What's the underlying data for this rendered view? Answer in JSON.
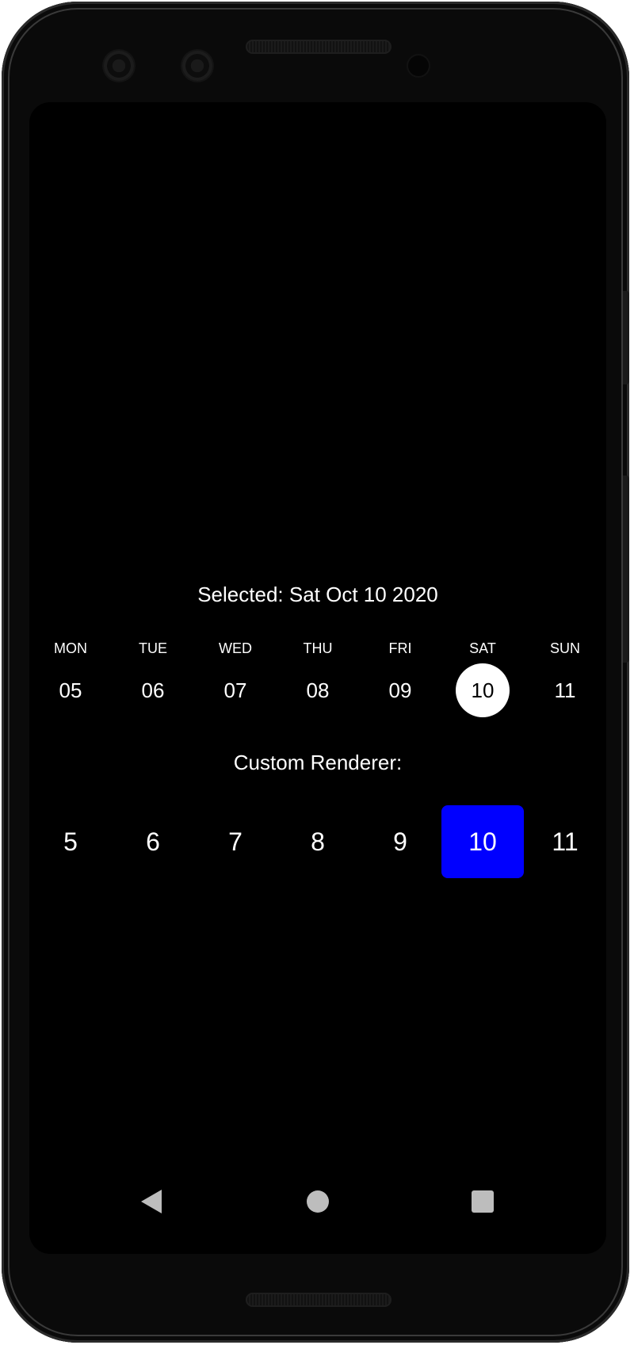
{
  "selected": {
    "label": "Selected: Sat Oct 10 2020"
  },
  "week": {
    "days": [
      {
        "weekday": "MON",
        "number": "05"
      },
      {
        "weekday": "TUE",
        "number": "06"
      },
      {
        "weekday": "WED",
        "number": "07"
      },
      {
        "weekday": "THU",
        "number": "08"
      },
      {
        "weekday": "FRI",
        "number": "09"
      },
      {
        "weekday": "SAT",
        "number": "10"
      },
      {
        "weekday": "SUN",
        "number": "11"
      }
    ],
    "selected_index": 5
  },
  "custom": {
    "label": "Custom Renderer:",
    "days": [
      "5",
      "6",
      "7",
      "8",
      "9",
      "10",
      "11"
    ],
    "selected_index": 5,
    "selected_color": "#0000ff"
  },
  "navbar": {
    "back_icon": "back-triangle-icon",
    "home_icon": "home-circle-icon",
    "recents_icon": "recents-square-icon"
  },
  "colors": {
    "screen_background": "#000000",
    "text": "#ffffff",
    "selected_circle": "#ffffff",
    "custom_selected": "#0000ff",
    "nav_icons": "#bdbdbd"
  }
}
